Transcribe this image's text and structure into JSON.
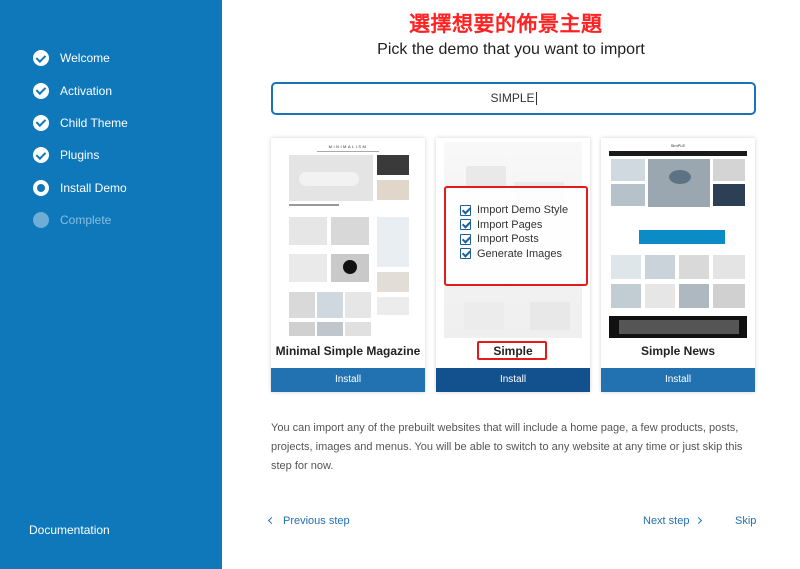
{
  "sidebar": {
    "steps": [
      {
        "label": "Welcome",
        "state": "done"
      },
      {
        "label": "Activation",
        "state": "done"
      },
      {
        "label": "Child Theme",
        "state": "done"
      },
      {
        "label": "Plugins",
        "state": "done"
      },
      {
        "label": "Install Demo",
        "state": "current"
      },
      {
        "label": "Complete",
        "state": "pending"
      }
    ],
    "documentation_label": "Documentation"
  },
  "annotation_label": "選擇想要的佈景主題",
  "main": {
    "heading": "Pick the demo that you want to import",
    "search_value": "SIMPLE",
    "demos": [
      {
        "title": "Minimal Simple Magazine",
        "preview_brand": "MINIMALISM",
        "install_label": "Install"
      },
      {
        "title": "Simple",
        "install_label": "Install"
      },
      {
        "title": "Simple News",
        "preview_brand": "SimPLE",
        "install_label": "Install"
      }
    ],
    "import_options": [
      "Import Demo Style",
      "Import Pages",
      "Import Posts",
      "Generate Images"
    ],
    "description": "You can import any of the prebuilt websites that will include a home page, a few products, posts, projects, images and menus. You will be able to switch to any website at any time or just skip this step for now.",
    "nav": {
      "previous_label": "Previous step",
      "next_label": "Next step",
      "skip_label": "Skip"
    }
  },
  "colors": {
    "sidebar_bg": "#0e78bb",
    "accent": "#2271b1",
    "annotation": "#ff2222"
  }
}
